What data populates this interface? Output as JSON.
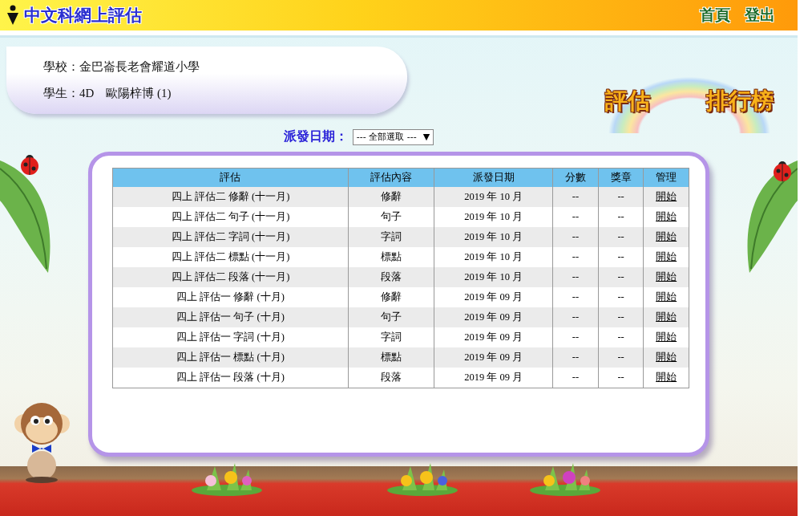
{
  "header": {
    "title": "中文科網上評估",
    "nav": [
      "首頁",
      "登出"
    ]
  },
  "student_info": {
    "school_label": "學校：",
    "school": "金巴崙長老會耀道小學",
    "student_label": "學生：",
    "class": "4D",
    "name": "歐陽梓博 (1)"
  },
  "ranking_logo": [
    "評估",
    "排行榜"
  ],
  "filter": {
    "label": "派發日期：",
    "value": "--- 全部選取 ---",
    "arrow": "▼"
  },
  "table": {
    "columns": [
      "評估",
      "評估內容",
      "派發日期",
      "分數",
      "獎章",
      "管理"
    ],
    "rows": [
      {
        "title": "四上 評估二 修辭 (十一月)",
        "content": "修辭",
        "date": "2019 年 10 月",
        "score": "--",
        "medal": "--",
        "action": "開始"
      },
      {
        "title": "四上 評估二 句子 (十一月)",
        "content": "句子",
        "date": "2019 年 10 月",
        "score": "--",
        "medal": "--",
        "action": "開始"
      },
      {
        "title": "四上 評估二 字詞 (十一月)",
        "content": "字詞",
        "date": "2019 年 10 月",
        "score": "--",
        "medal": "--",
        "action": "開始"
      },
      {
        "title": "四上 評估二 標點 (十一月)",
        "content": "標點",
        "date": "2019 年 10 月",
        "score": "--",
        "medal": "--",
        "action": "開始"
      },
      {
        "title": "四上 評估二 段落 (十一月)",
        "content": "段落",
        "date": "2019 年 10 月",
        "score": "--",
        "medal": "--",
        "action": "開始"
      },
      {
        "title": "四上 評估一 修辭 (十月)",
        "content": "修辭",
        "date": "2019 年 09 月",
        "score": "--",
        "medal": "--",
        "action": "開始"
      },
      {
        "title": "四上 評估一 句子 (十月)",
        "content": "句子",
        "date": "2019 年 09 月",
        "score": "--",
        "medal": "--",
        "action": "開始"
      },
      {
        "title": "四上 評估一 字詞 (十月)",
        "content": "字詞",
        "date": "2019 年 09 月",
        "score": "--",
        "medal": "--",
        "action": "開始"
      },
      {
        "title": "四上 評估一 標點 (十月)",
        "content": "標點",
        "date": "2019 年 09 月",
        "score": "--",
        "medal": "--",
        "action": "開始"
      },
      {
        "title": "四上 評估一 段落 (十月)",
        "content": "段落",
        "date": "2019 年 09 月",
        "score": "--",
        "medal": "--",
        "action": "開始"
      }
    ]
  }
}
